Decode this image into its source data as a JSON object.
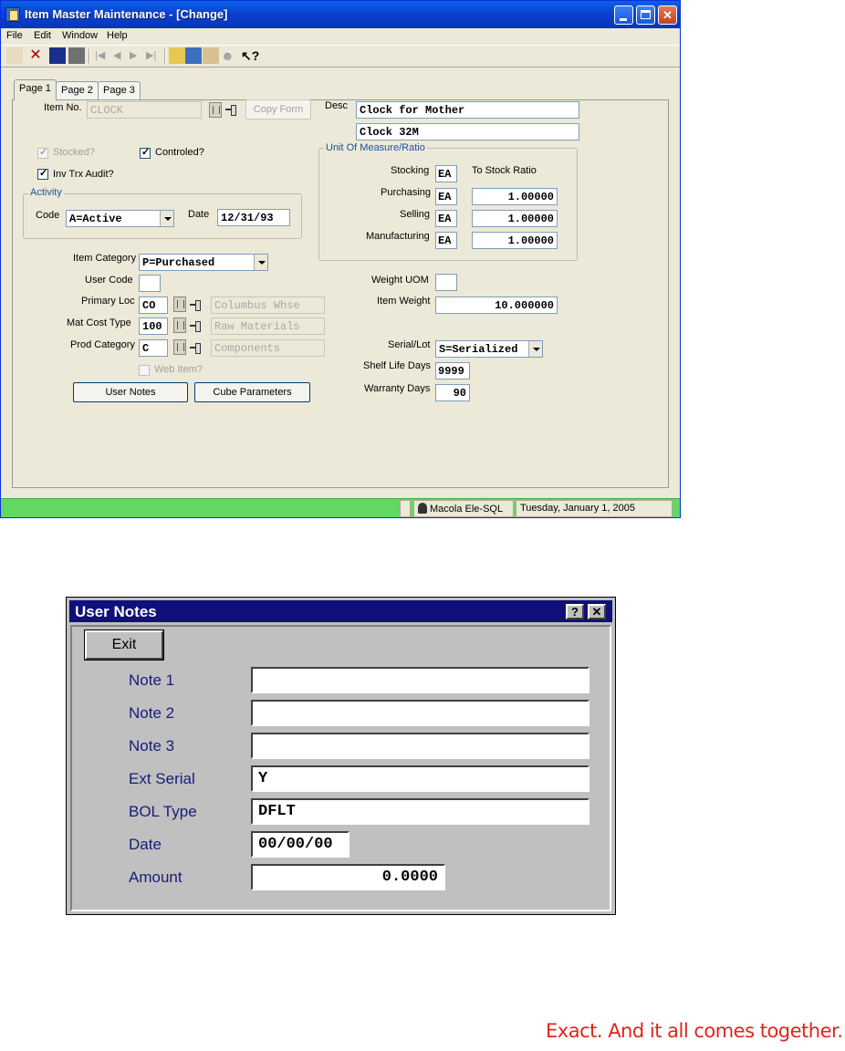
{
  "main_window": {
    "title": "Item Master Maintenance - [Change]",
    "menu": [
      "File",
      "Edit",
      "Window",
      "Help"
    ],
    "tabs": [
      "Page 1",
      "Page 2",
      "Page 3"
    ],
    "item_no_label": "Item No.",
    "item_no_value": "CLOCK",
    "copy_form_label": "Copy Form",
    "desc_label": "Desc",
    "desc_line1": "Clock for Mother",
    "desc_line2": "Clock 32M",
    "stocked_label": "Stocked?",
    "controlled_label": "Controled?",
    "inv_audit_label": "Inv Trx Audit?",
    "activity": {
      "title": "Activity",
      "code_label": "Code",
      "code_value": "A=Active",
      "date_label": "Date",
      "date_value": "12/31/93"
    },
    "uom": {
      "title": "Unit Of Measure/Ratio",
      "stocking_label": "Stocking",
      "stocking_value": "EA",
      "ratio_header": "To Stock Ratio",
      "purchasing_label": "Purchasing",
      "purchasing_value": "EA",
      "purchasing_ratio": "1.00000",
      "selling_label": "Selling",
      "selling_value": "EA",
      "selling_ratio": "1.00000",
      "manufacturing_label": "Manufacturing",
      "manufacturing_value": "EA",
      "manufacturing_ratio": "1.00000"
    },
    "item_category_label": "Item Category",
    "item_category_value": "P=Purchased",
    "user_code_label": "User Code",
    "user_code_value": "",
    "primary_loc_label": "Primary Loc",
    "primary_loc_value": "CO",
    "primary_loc_desc": "Columbus Whse",
    "mat_cost_type_label": "Mat Cost Type",
    "mat_cost_type_value": "100",
    "mat_cost_type_desc": "Raw Materials",
    "prod_category_label": "Prod Category",
    "prod_category_value": "C",
    "prod_category_desc": "Components",
    "web_item_label": "Web Item?",
    "user_notes_button": "User Notes",
    "cube_params_button": "Cube Parameters",
    "weight_uom_label": "Weight UOM",
    "weight_uom_value": "",
    "item_weight_label": "Item Weight",
    "item_weight_value": "10.000000",
    "serial_lot_label": "Serial/Lot",
    "serial_lot_value": "S=Serialized",
    "shelf_life_label": "Shelf Life Days",
    "shelf_life_value": "9999",
    "warranty_label": "Warranty Days",
    "warranty_value": "90",
    "status_app": "Macola Ele-SQL",
    "status_date": "Tuesday, January 1, 2005"
  },
  "notes_dialog": {
    "title": "User Notes",
    "exit_label": "Exit",
    "rows": [
      {
        "label": "Note 1",
        "value": ""
      },
      {
        "label": "Note 2",
        "value": ""
      },
      {
        "label": "Note 3",
        "value": ""
      },
      {
        "label": "Ext Serial",
        "value": "Y"
      },
      {
        "label": "BOL Type",
        "value": "DFLT"
      },
      {
        "label": "Date",
        "value": "00/00/00"
      },
      {
        "label": "Amount",
        "value": "0.0000"
      }
    ]
  },
  "tagline": "Exact. And it all comes together.",
  "colors": {
    "title_blue": "#0a5fe6",
    "status_green": "#62d862",
    "dialog_title": "#10107a",
    "tagline_red": "#e1251b"
  }
}
